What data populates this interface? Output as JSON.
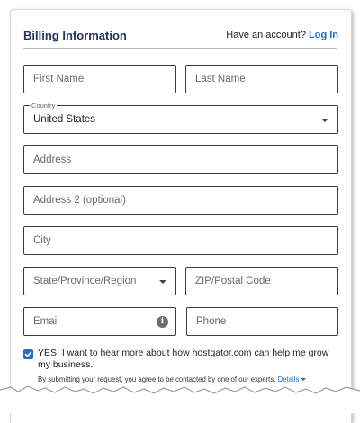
{
  "header": {
    "title": "Billing Information",
    "account_prompt": "Have an account?",
    "login_label": "Log In"
  },
  "form": {
    "first_name": {
      "placeholder": "First Name"
    },
    "last_name": {
      "placeholder": "Last Name"
    },
    "country": {
      "label": "Country",
      "value": "United States"
    },
    "address": {
      "placeholder": "Address"
    },
    "address2": {
      "placeholder": "Address 2 (optional)"
    },
    "city": {
      "placeholder": "City"
    },
    "state": {
      "placeholder": "State/Province/Region"
    },
    "zip": {
      "placeholder": "ZIP/Postal Code"
    },
    "email": {
      "placeholder": "Email"
    },
    "phone": {
      "placeholder": "Phone"
    }
  },
  "optin": {
    "checked": true,
    "text": "YES, I want to hear more about how hostgator.com can help me grow my business.",
    "disclaimer": "By submitting your request, you agree to be contacted by one of our experts.",
    "details_label": "Details"
  },
  "colors": {
    "title": "#23355f",
    "link": "#1f6fc5",
    "border": "#3b3b3b",
    "checkbox": "#1f6fc5"
  },
  "icons": {
    "country_dropdown": "chevron-down-icon",
    "state_dropdown": "chevron-down-icon",
    "email_info": "info-icon",
    "checkbox": "checkmark-icon",
    "details": "caret-down-icon"
  }
}
